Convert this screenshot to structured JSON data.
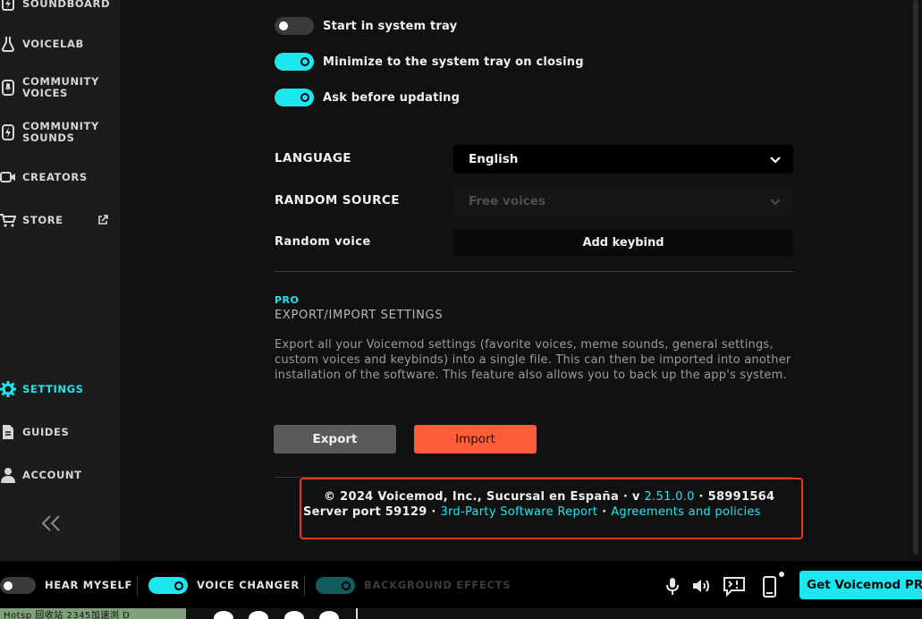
{
  "sidebar": {
    "items": [
      {
        "label": "SOUNDBOARD",
        "icon": "soundboard-icon"
      },
      {
        "label": "VOICELAB",
        "icon": "flask-icon"
      },
      {
        "label": "COMMUNITY\nVOICES",
        "icon": "microphone-icon"
      },
      {
        "label": "COMMUNITY\nSOUNDS",
        "icon": "lightning-icon"
      },
      {
        "label": "CREATORS",
        "icon": "camera-icon"
      },
      {
        "label": "STORE",
        "icon": "cart-icon"
      },
      {
        "label": "SETTINGS",
        "icon": "gear-icon",
        "active": true
      },
      {
        "label": "GUIDES",
        "icon": "document-icon"
      },
      {
        "label": "ACCOUNT",
        "icon": "user-icon"
      }
    ],
    "collapse_icon": "double-chevron-left-icon"
  },
  "settings": {
    "toggles": [
      {
        "label": "Start in system tray",
        "on": false
      },
      {
        "label": "Minimize to the system tray on closing",
        "on": true
      },
      {
        "label": "Ask before updating",
        "on": true
      }
    ],
    "language": {
      "label": "LANGUAGE",
      "value": "English"
    },
    "random_source": {
      "label": "RANDOM SOURCE",
      "value": "Free voices"
    },
    "random_voice": {
      "label": "Random voice",
      "button": "Add keybind"
    }
  },
  "export_section": {
    "tag": "PRO",
    "title": "EXPORT/IMPORT SETTINGS",
    "description": "Export all your Voicemod settings (favorite voices, meme sounds, general settings, custom voices and keybinds) into a single file. This can then be imported into another installation of the software. This feature also allows you to back up the app's system.",
    "export_label": "Export",
    "import_label": "Import"
  },
  "footer": {
    "copyright": "© 2024 Voicemod, Inc., Sucursal en España · v",
    "version": "2.51.0.0",
    "build": "· 58991564",
    "server_port": "Server port 59129 ·",
    "third_party_link": "3rd-Party Software Report",
    "sep": "·",
    "agreements_link": "Agreements and policies"
  },
  "bottom_bar": {
    "hear_myself": {
      "label": "HEAR MYSELF",
      "on": false
    },
    "voice_changer": {
      "label": "VOICE CHANGER",
      "on": true
    },
    "background_effects": {
      "label": "BACKGROUND EFFECTS",
      "on": false
    },
    "pro_button": "Get Voicemod PRO"
  },
  "taskbar": {
    "text": "Hotsp   回收站   2345加速浏  D"
  },
  "colors": {
    "accent": "#1ee6ee",
    "import": "#ff5c3a",
    "highlight_box": "#e03a2a"
  }
}
